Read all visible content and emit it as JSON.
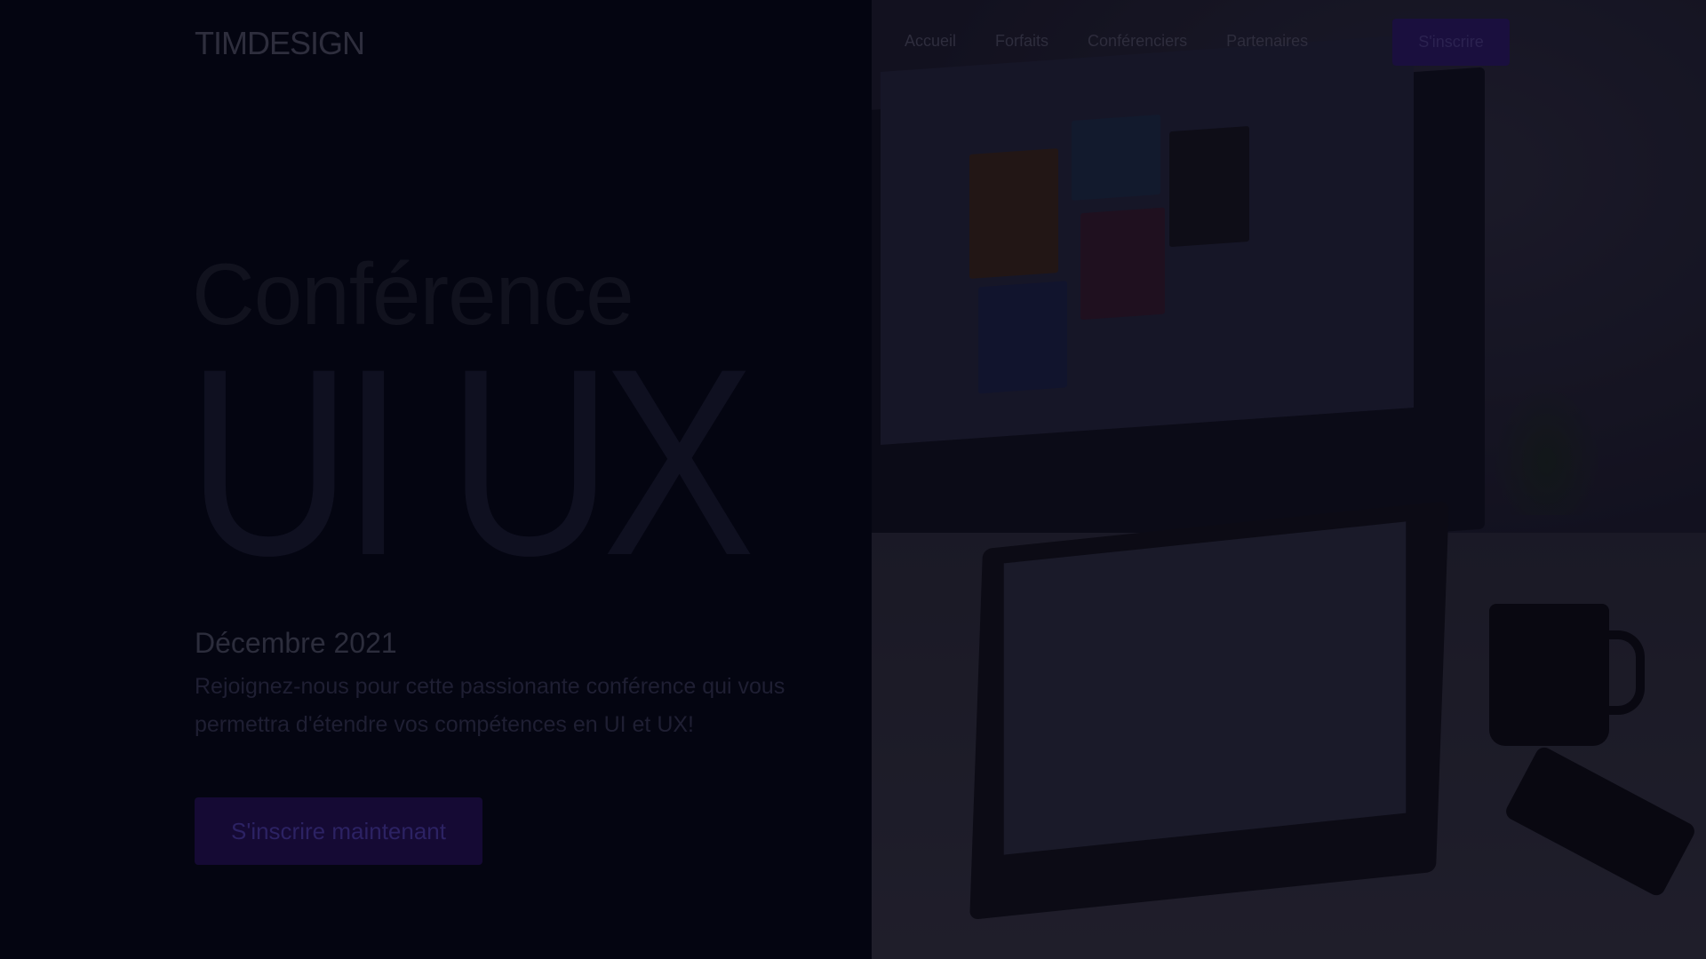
{
  "header": {
    "logo_bold": "TIM",
    "logo_light": "DESIGN",
    "nav": [
      {
        "label": "Accueil"
      },
      {
        "label": "Forfaits"
      },
      {
        "label": "Conférenciers"
      },
      {
        "label": "Partenaires"
      }
    ],
    "signup_button": "S'inscrire"
  },
  "hero": {
    "kicker": "Conférence",
    "title": "UI UX",
    "date": "Décembre 2021",
    "description": "Rejoignez-nous pour cette passionante conférence qui vous permettra d'étendre vos compétences en UI et UX!",
    "cta": "S'inscrire maintenant"
  },
  "colors": {
    "background": "#03040f",
    "accent": "#1a0f3e"
  }
}
